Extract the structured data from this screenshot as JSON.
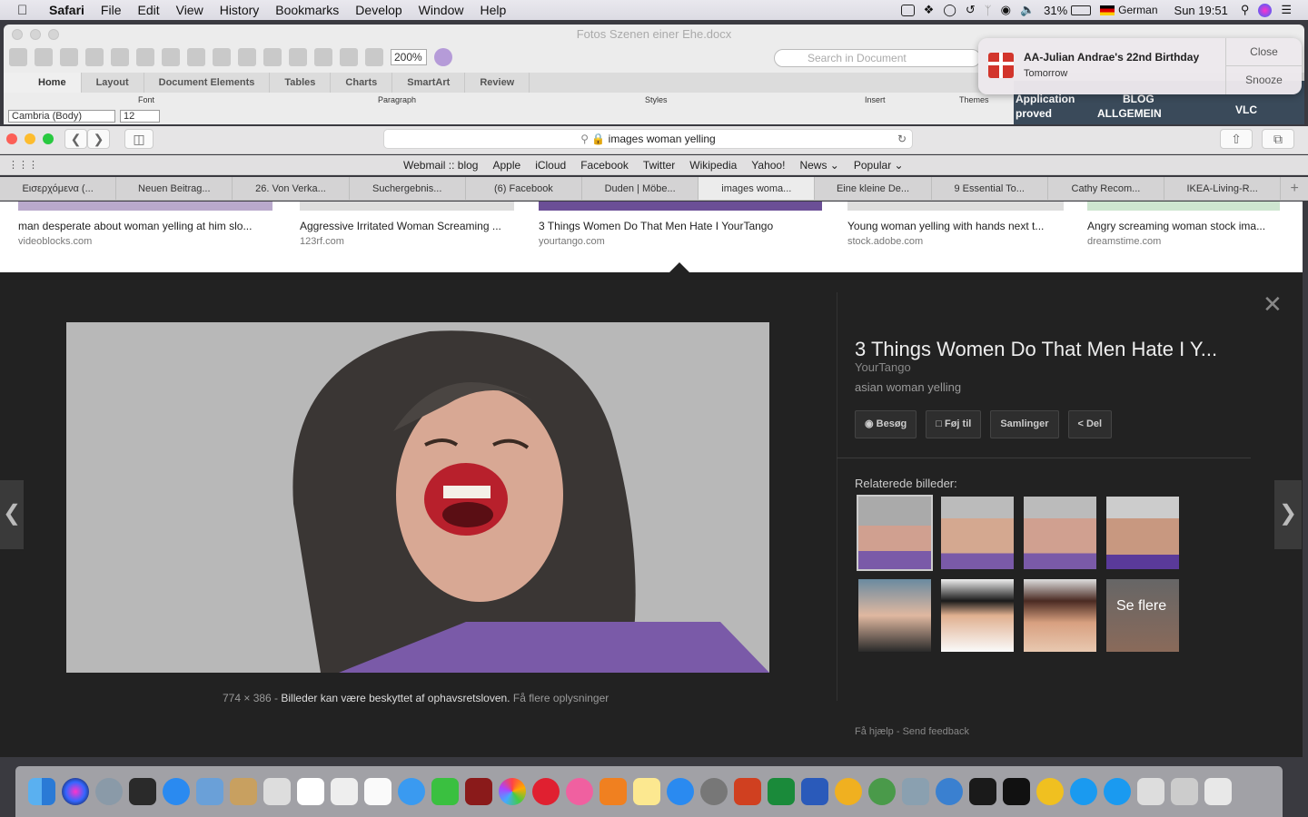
{
  "menubar": {
    "app": "Safari",
    "items": [
      "File",
      "Edit",
      "View",
      "History",
      "Bookmarks",
      "Develop",
      "Window",
      "Help"
    ],
    "battery": "31%",
    "lang": "German",
    "clock": "Sun 19:51"
  },
  "word": {
    "title": "Fotos Szenen einer Ehe.docx",
    "zoom": "200%",
    "search_placeholder": "Search in Document",
    "tabs": [
      "Home",
      "Layout",
      "Document Elements",
      "Tables",
      "Charts",
      "SmartArt",
      "Review"
    ],
    "groups": [
      "Font",
      "Paragraph",
      "Styles",
      "Insert",
      "Themes"
    ],
    "font": "Cambria (Body)",
    "size": "12",
    "behind": [
      "Application",
      "proved",
      "BLOG",
      "ALLGEMEIN",
      "VLC"
    ]
  },
  "notif": {
    "title": "AA-Julian Andrae's 22nd Birthday",
    "subtitle": "Tomorrow",
    "close": "Close",
    "snooze": "Snooze"
  },
  "safari": {
    "url": "images woman yelling",
    "favorites": [
      "Webmail :: blog",
      "Apple",
      "iCloud",
      "Facebook",
      "Twitter",
      "Wikipedia",
      "Yahoo!",
      "News ⌄",
      "Popular ⌄"
    ],
    "tabs": [
      "Εισερχόμενα (...",
      "Neuen Beitrag...",
      "26. Von Verka...",
      "Suchergebnis...",
      "(6) Facebook",
      "Duden | Möbe...",
      "images woma...",
      "Eine kleine De...",
      "9 Essential To...",
      "Cathy Recom...",
      "IKEA-Living-R..."
    ],
    "active_tab": 6
  },
  "results": [
    {
      "title": "man desperate about woman yelling at him slo...",
      "source": "videoblocks.com"
    },
    {
      "title": "Aggressive Irritated Woman Screaming ...",
      "source": "123rf.com"
    },
    {
      "title": "3 Things Women Do That Men Hate I YourTango",
      "source": "yourtango.com"
    },
    {
      "title": "Young woman yelling with hands next t...",
      "source": "stock.adobe.com"
    },
    {
      "title": "Angry screaming woman stock ima...",
      "source": "dreamstime.com"
    }
  ],
  "viewer": {
    "dimensions": "774 × 386",
    "notice": "Billeder kan være beskyttet af ophavsretsloven.",
    "more_info": "Få flere oplysninger",
    "title": "3 Things Women Do That Men Hate I Y...",
    "source": "YourTango",
    "description": "asian woman yelling",
    "actions": [
      "Besøg",
      "Føj til",
      "Samlinger",
      "Del"
    ],
    "related_label": "Relaterede billeder:",
    "see_more": "Se flere",
    "help": "Få hjælp",
    "feedback": "Send feedback"
  },
  "colors": {
    "purple": "#7a5aa8",
    "dark": "#222222"
  }
}
